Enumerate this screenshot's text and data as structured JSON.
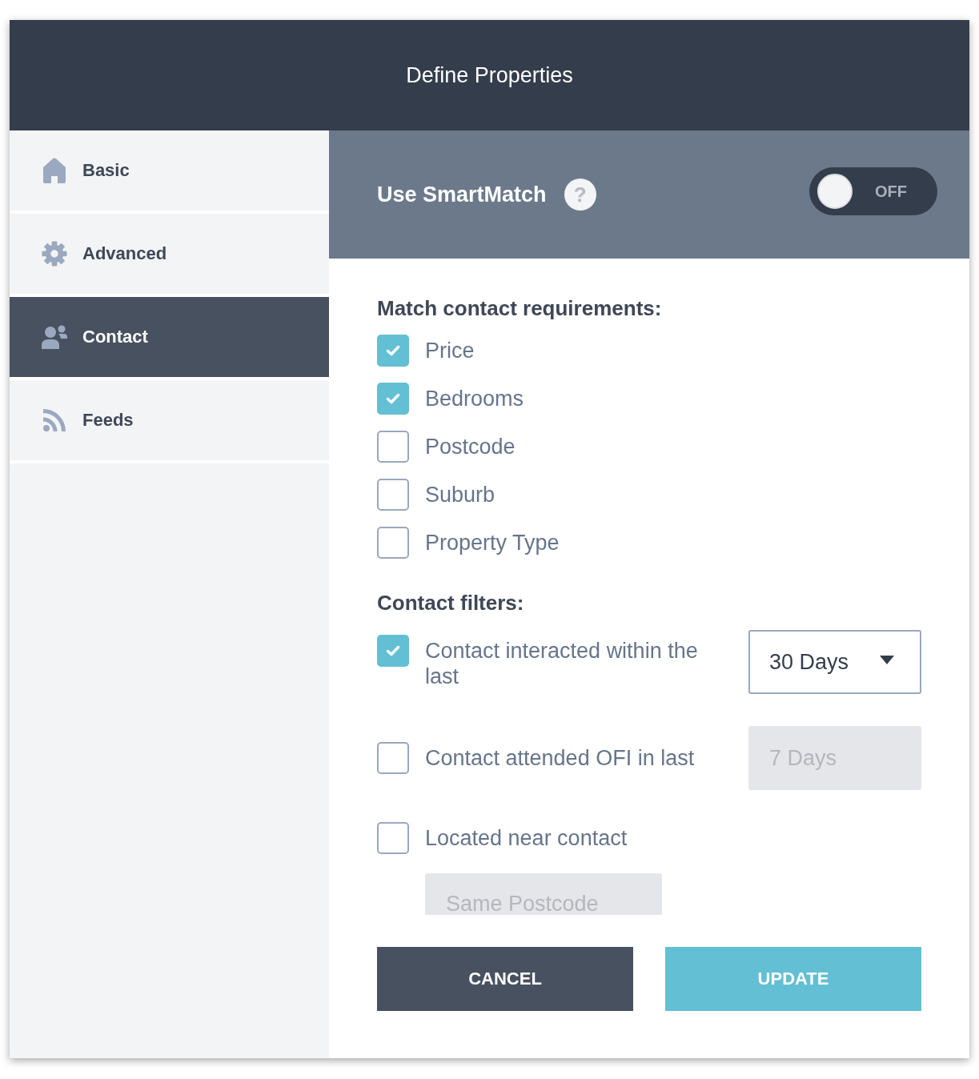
{
  "dialog": {
    "title": "Define Properties"
  },
  "sidebar": {
    "items": [
      {
        "label": "Basic",
        "kind": "home",
        "selected": false
      },
      {
        "label": "Advanced",
        "kind": "settings",
        "selected": false
      },
      {
        "label": "Contact",
        "kind": "people",
        "selected": true
      },
      {
        "label": "Feeds",
        "kind": "feed",
        "selected": false
      }
    ]
  },
  "smartmatch": {
    "label": "Use SmartMatch",
    "help": "?",
    "toggle": {
      "on": false,
      "label": "OFF"
    }
  },
  "requirements": {
    "heading": "Match contact requirements:",
    "options": [
      {
        "label": "Price",
        "checked": true
      },
      {
        "label": "Bedrooms",
        "checked": true
      },
      {
        "label": "Postcode",
        "checked": false
      },
      {
        "label": "Suburb",
        "checked": false
      },
      {
        "label": "Property Type",
        "checked": false
      }
    ]
  },
  "filters": {
    "heading": "Contact filters:",
    "rows": [
      {
        "kind": "inline",
        "label": "Contact interacted within the last",
        "checked": true,
        "select": {
          "value": "30 Days",
          "disabled": false
        }
      },
      {
        "kind": "inline",
        "label": "Contact attended OFI in last",
        "checked": false,
        "select": {
          "value": "7 Days",
          "disabled": true
        }
      },
      {
        "kind": "stacked",
        "label": "Located near contact",
        "checked": false,
        "select": {
          "value": "Same Postcode",
          "disabled": true
        }
      }
    ]
  },
  "buttons": [
    {
      "label": "CANCEL",
      "kind": "secondary"
    },
    {
      "label": "UPDATE",
      "kind": "primary"
    }
  ]
}
